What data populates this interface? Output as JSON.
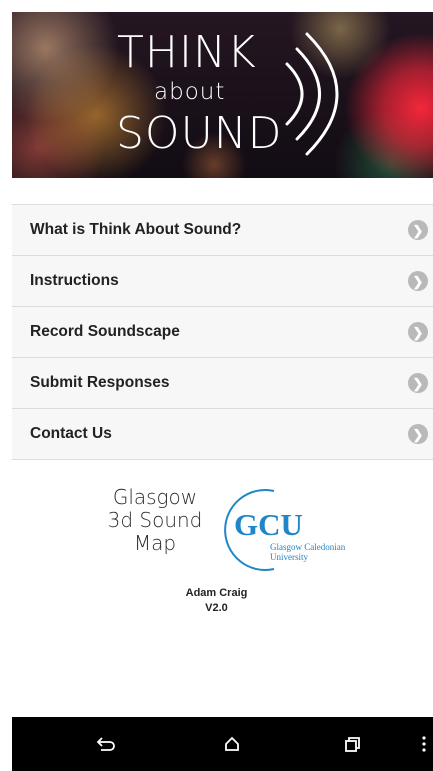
{
  "hero": {
    "title_line1": "THINK",
    "title_line2": "about",
    "title_line3": "SOUND"
  },
  "menu": {
    "items": [
      {
        "label": "What is Think About Sound?",
        "icon": "chevron-right-icon"
      },
      {
        "label": "Instructions",
        "icon": "chevron-right-icon"
      },
      {
        "label": "Record Soundscape",
        "icon": "chevron-right-icon"
      },
      {
        "label": "Submit Responses",
        "icon": "chevron-right-icon"
      },
      {
        "label": "Contact Us",
        "icon": "chevron-right-icon"
      }
    ]
  },
  "logos": {
    "glasgow_line1": "Glasgow",
    "glasgow_line2": "3d Sound",
    "glasgow_line3": "Map",
    "gcu_acronym": "GCU",
    "gcu_name_line1": "Glasgow Caledonian",
    "gcu_name_line2": "University"
  },
  "credit": {
    "author": "Adam Craig",
    "version": "V2.0"
  },
  "navbar": {
    "buttons": [
      "back-icon",
      "home-icon",
      "recent-apps-icon",
      "more-icon"
    ]
  },
  "colors": {
    "gcu_blue": "#1f86c7",
    "chevron_gray": "#b9b9b9",
    "navbar_bg": "#000000"
  }
}
